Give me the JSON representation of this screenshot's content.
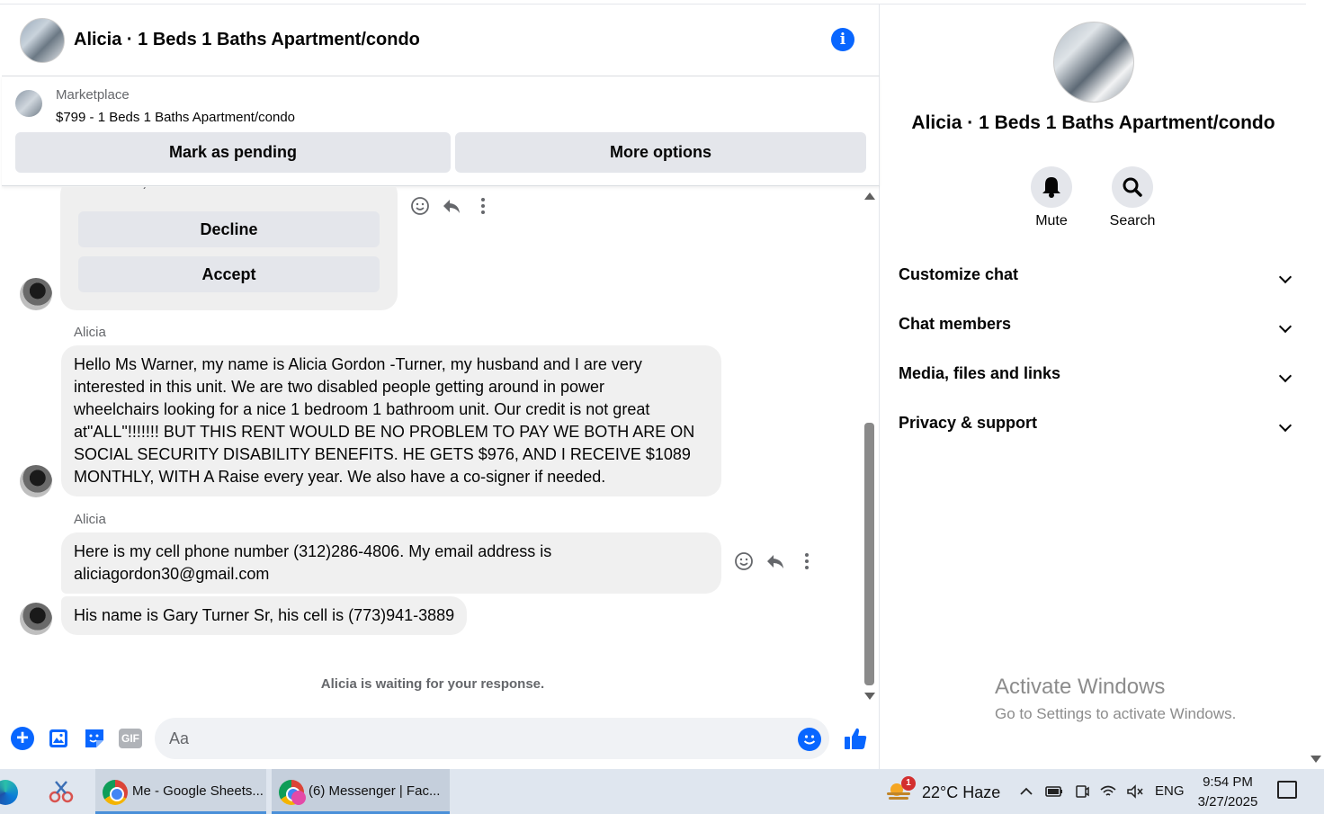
{
  "header": {
    "title": "Alicia · 1 Beds 1 Baths Apartment/condo",
    "info_glyph": "i"
  },
  "marketplace": {
    "label": "Marketplace",
    "listing": "$799 - 1 Beds 1 Baths Apartment/condo",
    "mark_pending": "Mark as pending",
    "more_options": "More options"
  },
  "offer_card": {
    "buyer_text": "buyer",
    "decline": "Decline",
    "accept": "Accept"
  },
  "messages": [
    {
      "sender": "Alicia",
      "lines": [
        "Hello Ms Warner, my name is Alicia Gordon -Turner, my husband and I are very",
        "interested in this unit. We are two disabled people getting around in power",
        "wheelchairs looking for a nice 1 bedroom 1 bathroom unit. Our credit is not great",
        "at\"ALL\"!!!!!!! BUT THIS RENT WOULD BE NO PROBLEM TO PAY WE BOTH ARE ON",
        "SOCIAL SECURITY DISABILITY BENEFITS. HE GETS $976, AND I RECEIVE $1089",
        "MONTHLY, WITH A Raise every year. We also have a co-signer if needed."
      ]
    },
    {
      "sender": "Alicia",
      "lines": [
        "Here is my cell phone number (312)286-4806. My email address is",
        "aliciagordon30@gmail.com"
      ]
    },
    {
      "sender": "",
      "lines": [
        "His name is Gary Turner Sr, his cell is (773)941-3889"
      ]
    }
  ],
  "waiting_text": "Alicia is waiting for your response.",
  "composer": {
    "placeholder": "Aa",
    "gif_label": "GIF",
    "plus_glyph": "+"
  },
  "info_pane": {
    "title": "Alicia · 1 Beds 1 Baths Apartment/condo",
    "mute_label": "Mute",
    "search_label": "Search",
    "sections": [
      "Customize chat",
      "Chat members",
      "Media, files and links",
      "Privacy & support"
    ]
  },
  "watermark": {
    "title": "Activate Windows",
    "subtitle": "Go to Settings to activate Windows."
  },
  "taskbar": {
    "windows": [
      {
        "label": "Me - Google Sheets..."
      },
      {
        "label": "(6) Messenger | Fac..."
      }
    ],
    "weather_badge": "1",
    "weather": "22°C  Haze",
    "lang": "ENG",
    "time": "9:54 PM",
    "date": "3/27/2025"
  },
  "colors": {
    "accent": "#0866ff",
    "bubble": "#f0f0f0",
    "button": "#e4e6eb",
    "taskbar": "#dfe6ef"
  }
}
